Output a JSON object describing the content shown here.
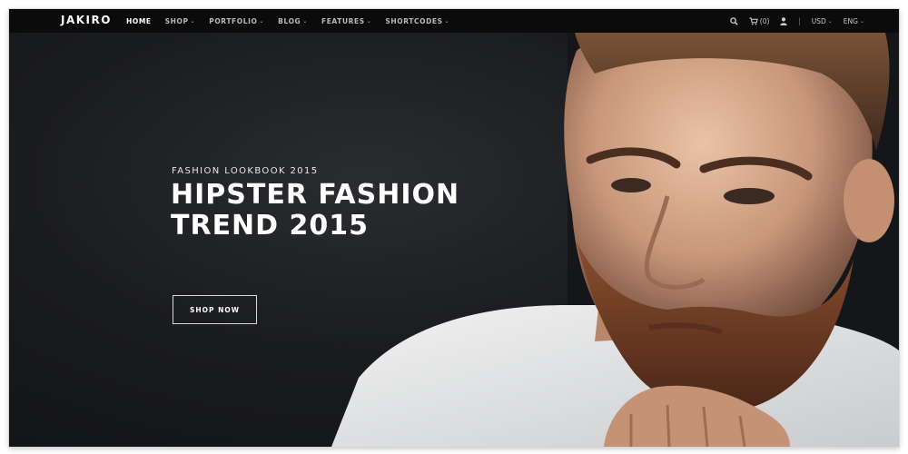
{
  "brand": {
    "logo": "JAKIRO"
  },
  "nav": {
    "items": [
      {
        "label": "HOME",
        "active": true,
        "dropdown": false
      },
      {
        "label": "SHOP",
        "active": false,
        "dropdown": true
      },
      {
        "label": "PORTFOLIO",
        "active": false,
        "dropdown": true
      },
      {
        "label": "BLOG",
        "active": false,
        "dropdown": true
      },
      {
        "label": "FEATURES",
        "active": false,
        "dropdown": true
      },
      {
        "label": "SHORTCODES",
        "active": false,
        "dropdown": true
      }
    ],
    "right": {
      "search_icon": "search-icon",
      "cart_icon": "cart-icon",
      "cart_count": "(0)",
      "user_icon": "user-icon",
      "separator": "|",
      "currency": "USD",
      "language": "ENG"
    }
  },
  "hero": {
    "eyebrow": "FASHION LOOKBOOK 2015",
    "headline_line1": "HIPSTER FASHION",
    "headline_line2": "TREND 2015",
    "cta_label": "SHOP NOW",
    "image": "man-with-beard-portrait"
  },
  "colors": {
    "nav_bg": "#0b0b0c",
    "hero_bg": "#1b1c1f",
    "text_primary": "#ffffff",
    "text_nav": "#b9b9b9"
  }
}
